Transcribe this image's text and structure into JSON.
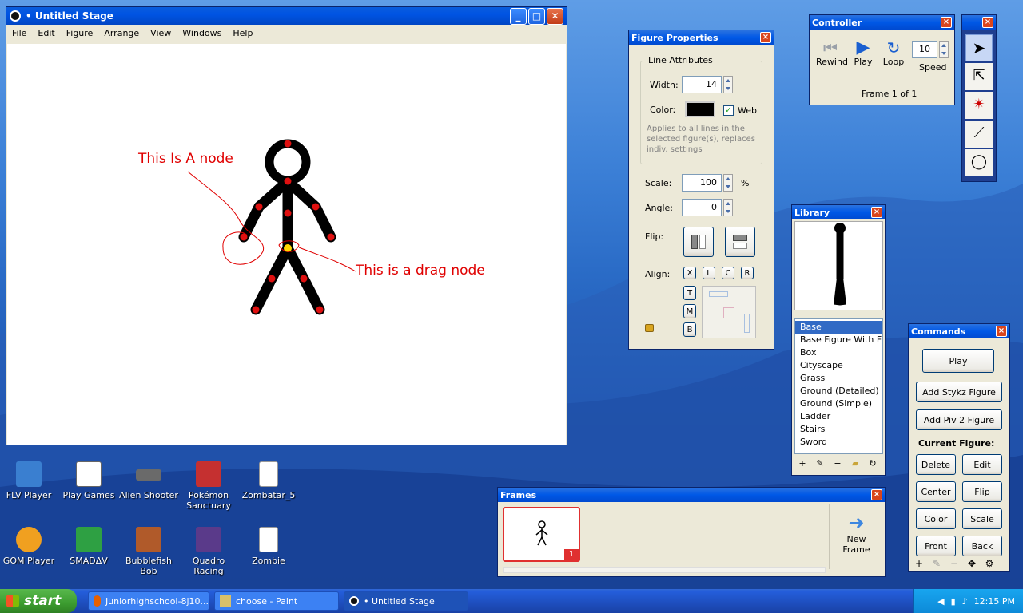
{
  "stage_window": {
    "title": "• Untitled Stage",
    "menu": [
      "File",
      "Edit",
      "Figure",
      "Arrange",
      "View",
      "Windows",
      "Help"
    ],
    "annotation_node": "This Is A node",
    "annotation_drag": "This is a drag node"
  },
  "figure_properties": {
    "title": "Figure Properties",
    "group_label": "Line Attributes",
    "width_label": "Width:",
    "width_value": "14",
    "color_label": "Color:",
    "web_label": "Web",
    "web_checked": true,
    "note": "Applies to all lines in the selected figure(s), replaces indiv. settings",
    "scale_label": "Scale:",
    "scale_value": "100",
    "scale_unit": "%",
    "angle_label": "Angle:",
    "angle_value": "0",
    "flip_label": "Flip:",
    "align_label": "Align:",
    "align_x": [
      "X",
      "L",
      "C",
      "R"
    ],
    "align_y": [
      "T",
      "M",
      "B"
    ]
  },
  "controller": {
    "title": "Controller",
    "rewind_label": "Rewind",
    "play_label": "Play",
    "loop_label": "Loop",
    "speed_value": "10",
    "speed_label": "Speed",
    "frame_status": "Frame 1 of 1"
  },
  "library": {
    "title": "Library",
    "items": [
      "Base",
      "Base Figure With F",
      "Box",
      "Cityscape",
      "Grass",
      "Ground (Detailed)",
      "Ground (Simple)",
      "Ladder",
      "Stairs",
      "Sword"
    ],
    "selected_index": 0
  },
  "commands": {
    "title": "Commands",
    "play_label": "Play",
    "add_stykz_label": "Add Stykz Figure",
    "add_piv_label": "Add Piv 2 Figure",
    "current_figure_label": "Current Figure:",
    "delete_label": "Delete",
    "edit_label": "Edit",
    "center_label": "Center",
    "flip_label": "Flip",
    "color_label": "Color",
    "scale_label": "Scale",
    "front_label": "Front",
    "back_label": "Back"
  },
  "frames": {
    "title": "Frames",
    "frame_number": "1",
    "new_frame_label": "New\nFrame"
  },
  "desktop_icons": [
    {
      "label": "FLV Player"
    },
    {
      "label": "Play Games"
    },
    {
      "label": "Alien Shooter"
    },
    {
      "label": "Pokémon Sanctuary"
    },
    {
      "label": "Zombatar_5"
    },
    {
      "label": "GOM Player"
    },
    {
      "label": "SMADΔV"
    },
    {
      "label": "Bubblefish Bob"
    },
    {
      "label": "Quadro Racing"
    },
    {
      "label": "Zombie"
    }
  ],
  "taskbar": {
    "start_label": "start",
    "items": [
      "Juniorhighschool-8j10...",
      "choose - Paint",
      "• Untitled Stage"
    ],
    "active_index": 2,
    "clock": "12:15 PM"
  },
  "colors": {
    "node_red": "#e01010",
    "drag_node_yellow": "#ffd700",
    "annotation_red": "#e00000",
    "xp_blue": "#0054e3"
  }
}
